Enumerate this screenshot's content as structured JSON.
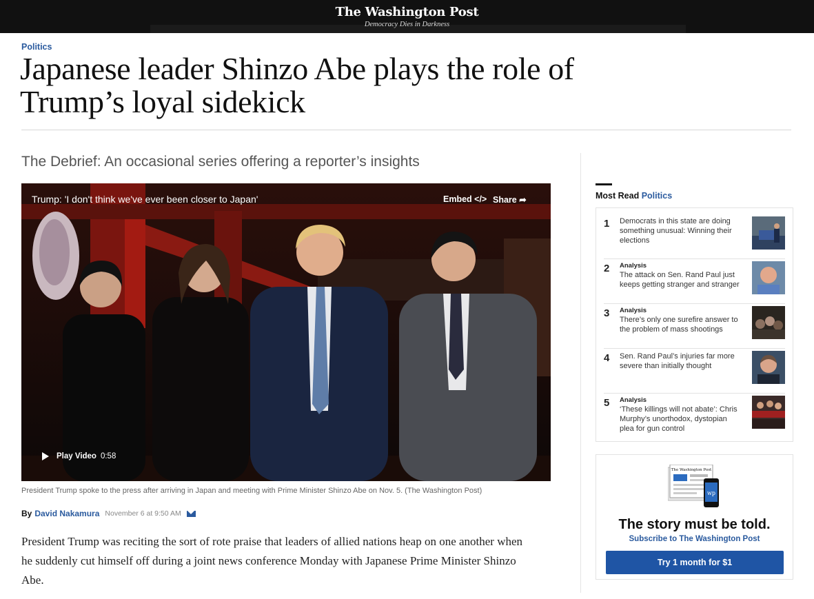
{
  "masthead": {
    "logo": "The Washington Post",
    "tagline": "Democracy Dies in Darkness"
  },
  "article": {
    "section": "Politics",
    "headline_line1": "Japanese leader Shinzo Abe plays the role of",
    "headline_line2": "Trump’s loyal sidekick",
    "subhead": "The Debrief: An occasional series offering a reporter’s insights",
    "byline_label": "By",
    "author": "David Nakamura",
    "date": "November 6 at 9:50 AM",
    "body_line1": "President Trump was reciting the sort of rote praise that leaders of allied nations heap on one another when",
    "body_line2": "he suddenly cut himself off during a joint news conference Monday with Japanese Prime Minister Shinzo",
    "body_line3": "Abe."
  },
  "video": {
    "title": "Trump: 'I don't think we've ever been closer to Japan'",
    "embed_label": "Embed </>",
    "share_label": "Share",
    "play_label": "Play Video",
    "duration": "0:58",
    "caption": "President Trump spoke to the press after arriving in Japan and meeting with Prime Minister Shinzo Abe on Nov. 5. (The Washington Post)"
  },
  "most_read": {
    "title": "Most Read",
    "section": "Politics",
    "items": [
      {
        "rank": "1",
        "label": "",
        "line1": "Democrats in this state are doing",
        "line2": "something unusual: Winning their",
        "line3": "elections"
      },
      {
        "rank": "2",
        "label": "Analysis",
        "line1": "The attack on Sen. Rand Paul just",
        "line2": "keeps getting stranger and stranger",
        "line3": ""
      },
      {
        "rank": "3",
        "label": "Analysis",
        "line1": "There’s only one surefire answer to",
        "line2": "the problem of mass shootings",
        "line3": ""
      },
      {
        "rank": "4",
        "label": "",
        "line1": "Sen. Rand Paul’s injuries far more",
        "line2": "severe than initially thought",
        "line3": ""
      },
      {
        "rank": "5",
        "label": "Analysis",
        "line1": "‘These killings will not abate’: Chris",
        "line2": "Murphy’s unorthodox, dystopian",
        "line3": "plea for gun control"
      }
    ]
  },
  "promo": {
    "graphic_logo": "The Washington Post",
    "app_label": "wp",
    "headline": "The story must be told.",
    "subline": "Subscribe to The Washington Post",
    "button": "Try 1 month for $1"
  },
  "colors": {
    "accent_blue": "#2a5a9e",
    "button_blue": "#1f55a5",
    "masthead": "#111111"
  }
}
